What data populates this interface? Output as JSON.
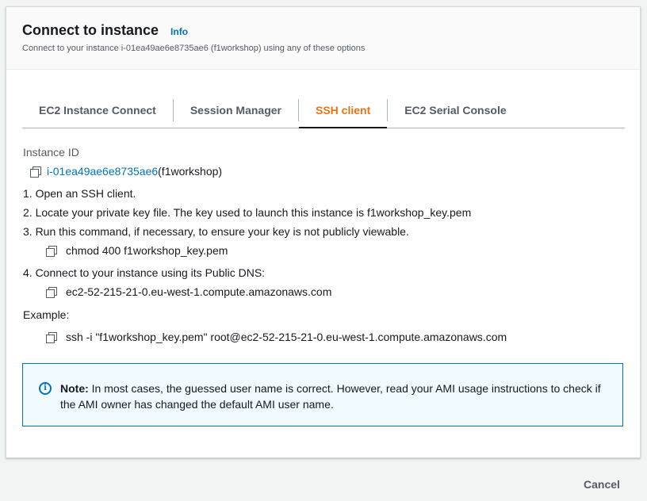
{
  "header": {
    "title": "Connect to instance",
    "info_link": "Info",
    "subtitle": "Connect to your instance i-01ea49ae6e8735ae6 (f1workshop) using any of these options"
  },
  "tabs": [
    {
      "label": "EC2 Instance Connect",
      "active": false
    },
    {
      "label": "Session Manager",
      "active": false
    },
    {
      "label": "SSH client",
      "active": true
    },
    {
      "label": "EC2 Serial Console",
      "active": false
    }
  ],
  "ssh": {
    "instance_id_label": "Instance ID",
    "instance_id": "i-01ea49ae6e8735ae6",
    "instance_name": " (f1workshop)",
    "step1": "1. Open an SSH client.",
    "step2": "2. Locate your private key file. The key used to launch this instance is f1workshop_key.pem",
    "step3": "3. Run this command, if necessary, to ensure your key is not publicly viewable.",
    "chmod_command": "chmod 400 f1workshop_key.pem",
    "step4": "4. Connect to your instance using its Public DNS:",
    "public_dns": "ec2-52-215-21-0.eu-west-1.compute.amazonaws.com",
    "example_label": "Example:",
    "example_command": "ssh -i \"f1workshop_key.pem\" root@ec2-52-215-21-0.eu-west-1.compute.amazonaws.com"
  },
  "note": {
    "icon": "info-icon",
    "bold": "Note:",
    "text": " In most cases, the guessed user name is correct. However, read your AMI usage instructions to check if the AMI owner has changed the default AMI user name."
  },
  "footer": {
    "cancel_label": "Cancel"
  },
  "colors": {
    "accent": "#ec7211",
    "link": "#0073bb",
    "note_bg": "#f1faff"
  }
}
